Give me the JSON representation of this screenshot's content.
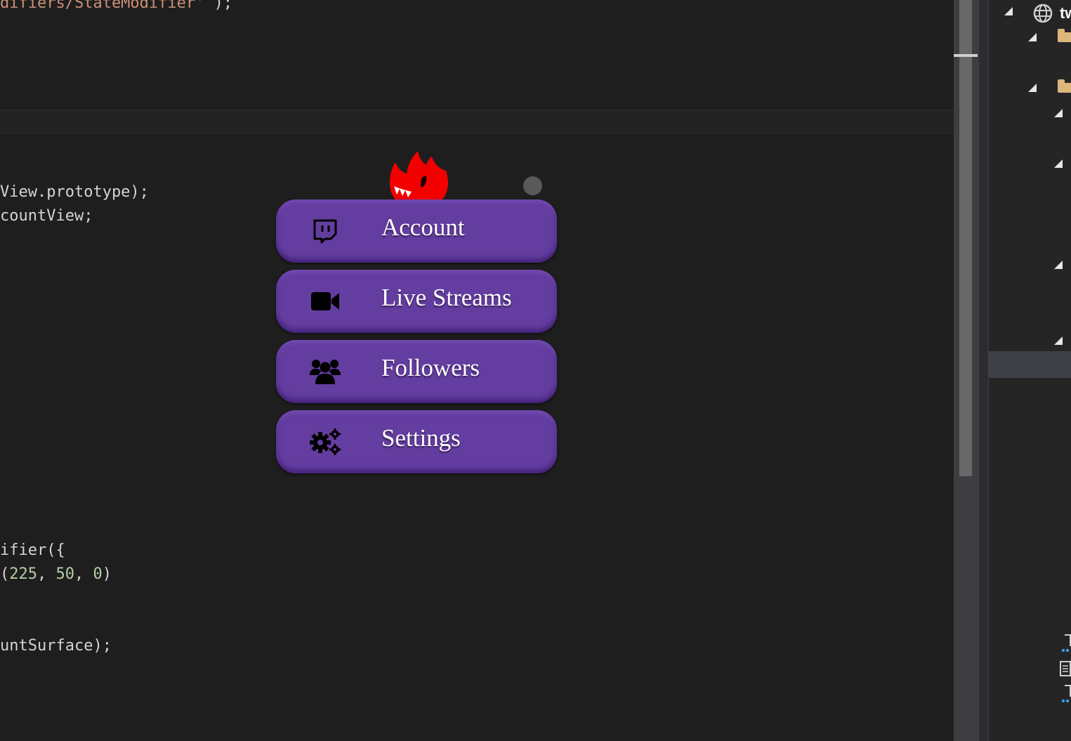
{
  "editor": {
    "lines": [
      {
        "plain": "difiers/StateModifier",
        "string": "'",
        "rest": ");"
      },
      {
        "text": "View.prototype);"
      },
      {
        "text": "countView;"
      },
      {
        "text": "ifier({"
      },
      {
        "prefix": "(",
        "n1": "225",
        "sep1": ", ",
        "n2": "50",
        "sep2": ", ",
        "n3": "0",
        "suffix": ")"
      },
      {
        "text": "untSurface);"
      }
    ]
  },
  "explorer": {
    "root_label": "tw",
    "icons": [
      "globe-icon",
      "folder-icon",
      "folder-icon",
      "file-icon"
    ]
  },
  "menu": {
    "logo": "flame-icon",
    "items": [
      {
        "label": "Account",
        "icon": "twitch-icon"
      },
      {
        "label": "Live Streams",
        "icon": "video-camera-icon"
      },
      {
        "label": "Followers",
        "icon": "users-icon"
      },
      {
        "label": "Settings",
        "icon": "gears-icon"
      }
    ]
  },
  "colors": {
    "button": "#643da0",
    "logo": "#f20000",
    "editor_bg": "#1e1e1e"
  }
}
